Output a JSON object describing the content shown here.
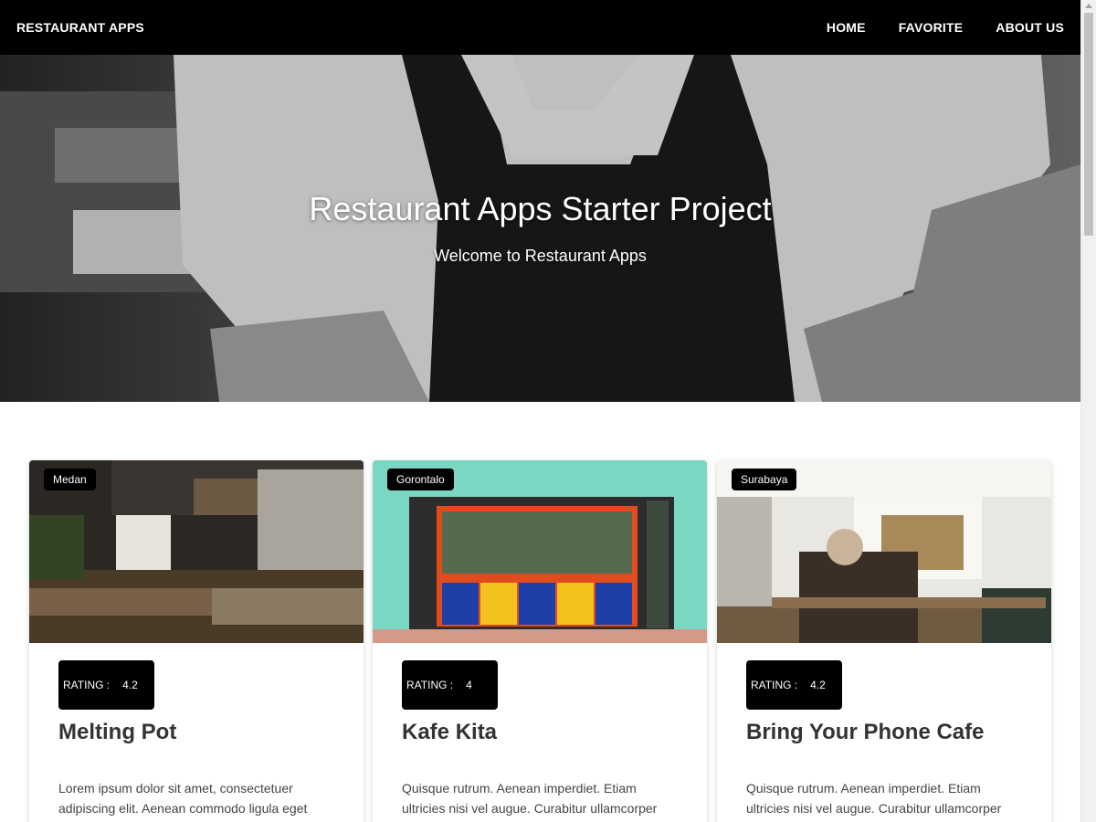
{
  "navbar": {
    "brand": "RESTAURANT APPS",
    "links": [
      "HOME",
      "FAVORITE",
      "ABOUT US"
    ]
  },
  "hero": {
    "title": "Restaurant Apps Starter Project",
    "subtitle": "Welcome to Restaurant Apps"
  },
  "restaurants": [
    {
      "city": "Medan",
      "rating_label": "RATING :",
      "rating": "4.2",
      "name": "Melting Pot",
      "description": "Lorem ipsum dolor sit amet, consectetuer adipiscing elit. Aenean commodo ligula eget dolor. Aenean massa. Cum sociis natoque"
    },
    {
      "city": "Gorontalo",
      "rating_label": "RATING :",
      "rating": "4",
      "name": "Kafe Kita",
      "description": "Quisque rutrum. Aenean imperdiet. Etiam ultricies nisi vel augue. Curabitur ullamcorper ultricies nisi. Nam eget dui. Etiam rhoncus"
    },
    {
      "city": "Surabaya",
      "rating_label": "RATING :",
      "rating": "4.2",
      "name": "Bring Your Phone Cafe",
      "description": "Quisque rutrum. Aenean imperdiet. Etiam ultricies nisi vel augue. Curabitur ullamcorper ultricies nisi. Nam eget dui. Etiam rhoncus"
    }
  ]
}
